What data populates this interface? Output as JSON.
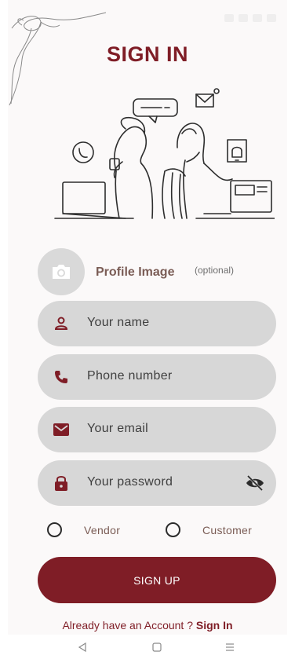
{
  "title": "SIGN IN",
  "profile": {
    "label": "Profile Image",
    "optional": "(optional)",
    "avatar_icon": "camera-icon"
  },
  "fields": [
    {
      "icon": "person-icon",
      "placeholder": "Your name"
    },
    {
      "icon": "phone-icon",
      "placeholder": "Phone number"
    },
    {
      "icon": "mail-icon",
      "placeholder": "Your email"
    },
    {
      "icon": "lock-icon",
      "placeholder": "Your password",
      "trailing_icon": "eye-off-icon"
    }
  ],
  "roles": [
    {
      "label": "Vendor",
      "selected": false
    },
    {
      "label": "Customer",
      "selected": false
    }
  ],
  "signup_button": "SIGN UP",
  "footer": {
    "prompt": "Already have an Account ? ",
    "link": "Sign In"
  },
  "colors": {
    "brand": "#7f1d26",
    "field_bg": "#d7d7d7",
    "label_brown": "#7a5c55"
  },
  "nav": [
    "back-icon",
    "home-icon",
    "menu-icon"
  ]
}
